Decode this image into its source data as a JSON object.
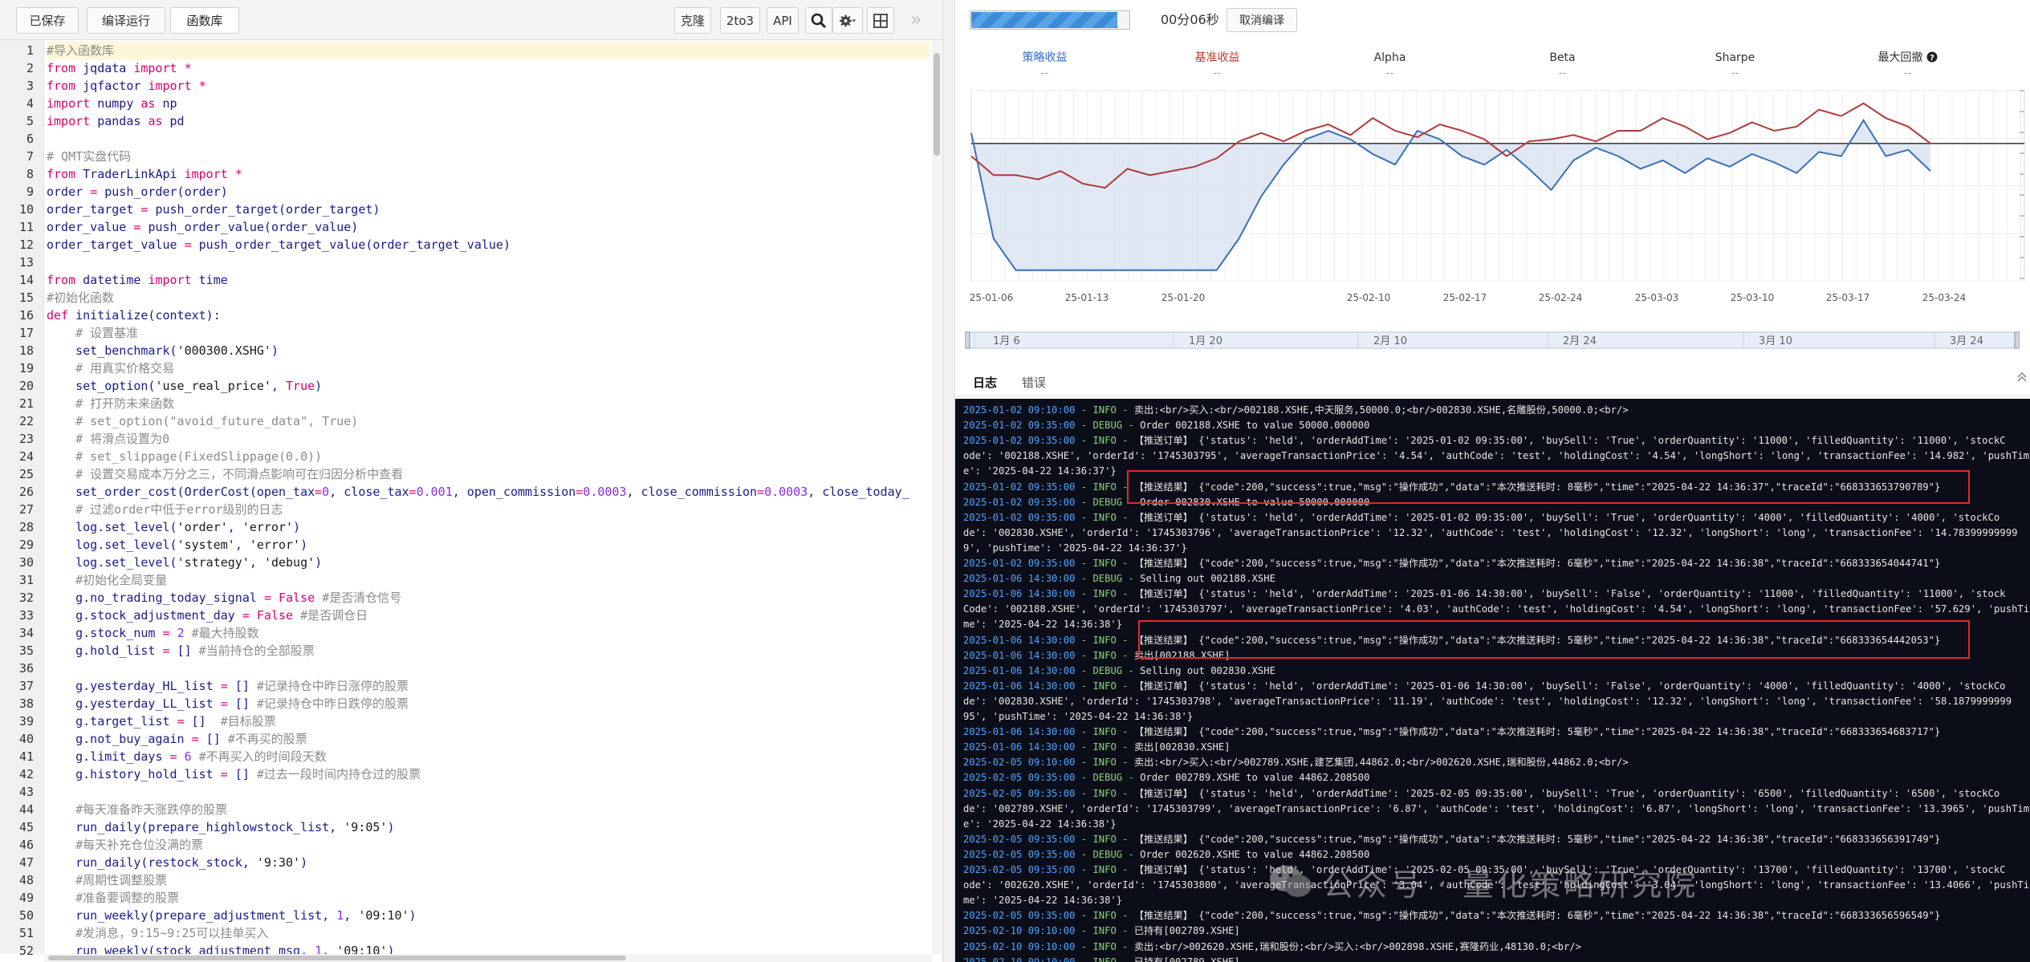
{
  "toolbar": {
    "saved": "已保存",
    "compile_run": "编译运行",
    "library": "函数库",
    "clone": "克隆",
    "to3": "2to3",
    "api": "API",
    "collapse": "»"
  },
  "code_lines": [
    [
      [
        "cm",
        "#导入函数库"
      ]
    ],
    [
      [
        "kw",
        "from "
      ],
      [
        "fn",
        "jqdata "
      ],
      [
        "kw",
        "import "
      ],
      [
        "kw",
        "*"
      ]
    ],
    [
      [
        "kw",
        "from "
      ],
      [
        "fn",
        "jqfactor "
      ],
      [
        "kw",
        "import "
      ],
      [
        "kw",
        "*"
      ]
    ],
    [
      [
        "kw",
        "import "
      ],
      [
        "fn",
        "numpy "
      ],
      [
        "kw",
        "as "
      ],
      [
        "fn",
        "np"
      ]
    ],
    [
      [
        "kw",
        "import "
      ],
      [
        "fn",
        "pandas "
      ],
      [
        "kw",
        "as "
      ],
      [
        "fn",
        "pd"
      ]
    ],
    [],
    [
      [
        "cm",
        "# QMT实盘代码"
      ]
    ],
    [
      [
        "kw",
        "from "
      ],
      [
        "fn",
        "TraderLinkApi "
      ],
      [
        "kw",
        "import "
      ],
      [
        "kw",
        "*"
      ]
    ],
    [
      [
        "fn",
        "order "
      ],
      [
        "kw",
        "= "
      ],
      [
        "fn",
        "push_order(order)"
      ]
    ],
    [
      [
        "fn",
        "order_target "
      ],
      [
        "kw",
        "= "
      ],
      [
        "fn",
        "push_order_target(order_target)"
      ]
    ],
    [
      [
        "fn",
        "order_value "
      ],
      [
        "kw",
        "= "
      ],
      [
        "fn",
        "push_order_value(order_value)"
      ]
    ],
    [
      [
        "fn",
        "order_target_value "
      ],
      [
        "kw",
        "= "
      ],
      [
        "fn",
        "push_order_target_value(order_target_value)"
      ]
    ],
    [],
    [
      [
        "kw",
        "from "
      ],
      [
        "fn",
        "datetime "
      ],
      [
        "kw",
        "import "
      ],
      [
        "fn",
        "time"
      ]
    ],
    [
      [
        "cm",
        "#初始化函数"
      ]
    ],
    [
      [
        "df",
        "def "
      ],
      [
        "fn",
        "initialize(context):"
      ]
    ],
    [
      [
        "cm",
        "    # 设置基准"
      ]
    ],
    [
      [
        "fn",
        "    set_benchmark("
      ],
      [
        "str",
        "'000300.XSHG'"
      ],
      [
        "fn",
        ")"
      ]
    ],
    [
      [
        "cm",
        "    # 用真实价格交易"
      ]
    ],
    [
      [
        "fn",
        "    set_option("
      ],
      [
        "str",
        "'use_real_price'"
      ],
      [
        "fn",
        ", "
      ],
      [
        "kw",
        "True"
      ],
      [
        "fn",
        ")"
      ]
    ],
    [
      [
        "cm",
        "    # 打开防未来函数"
      ]
    ],
    [
      [
        "cm",
        "    # set_option(\"avoid_future_data\", True)"
      ]
    ],
    [
      [
        "cm",
        "    # 将滑点设置为0"
      ]
    ],
    [
      [
        "cm",
        "    # set_slippage(FixedSlippage(0.0))"
      ]
    ],
    [
      [
        "cm",
        "    # 设置交易成本万分之三，不同滑点影响可在归因分析中查看"
      ]
    ],
    [
      [
        "fn",
        "    set_order_cost(OrderCost(open_tax"
      ],
      [
        "kw",
        "="
      ],
      [
        "num",
        "0"
      ],
      [
        "fn",
        ", close_tax"
      ],
      [
        "kw",
        "="
      ],
      [
        "num",
        "0.001"
      ],
      [
        "fn",
        ", open_commission"
      ],
      [
        "kw",
        "="
      ],
      [
        "num",
        "0.0003"
      ],
      [
        "fn",
        ", close_commission"
      ],
      [
        "kw",
        "="
      ],
      [
        "num",
        "0.0003"
      ],
      [
        "fn",
        ", close_today_"
      ]
    ],
    [
      [
        "cm",
        "    # 过滤order中低于error级别的日志"
      ]
    ],
    [
      [
        "fn",
        "    log.set_level("
      ],
      [
        "str",
        "'order'"
      ],
      [
        "fn",
        ", "
      ],
      [
        "str",
        "'error'"
      ],
      [
        "fn",
        ")"
      ]
    ],
    [
      [
        "fn",
        "    log.set_level("
      ],
      [
        "str",
        "'system'"
      ],
      [
        "fn",
        ", "
      ],
      [
        "str",
        "'error'"
      ],
      [
        "fn",
        ")"
      ]
    ],
    [
      [
        "fn",
        "    log.set_level("
      ],
      [
        "str",
        "'strategy'"
      ],
      [
        "fn",
        ", "
      ],
      [
        "str",
        "'debug'"
      ],
      [
        "fn",
        ")"
      ]
    ],
    [
      [
        "cm",
        "    #初始化全局变量"
      ]
    ],
    [
      [
        "fn",
        "    g.no_trading_today_signal "
      ],
      [
        "kw",
        "= False "
      ],
      [
        "cm",
        "#是否清仓信号"
      ]
    ],
    [
      [
        "fn",
        "    g.stock_adjustment_day "
      ],
      [
        "kw",
        "= False "
      ],
      [
        "cm",
        "#是否调仓日"
      ]
    ],
    [
      [
        "fn",
        "    g.stock_num "
      ],
      [
        "kw",
        "= "
      ],
      [
        "num",
        "2 "
      ],
      [
        "cm",
        "#最大持股数"
      ]
    ],
    [
      [
        "fn",
        "    g.hold_list "
      ],
      [
        "kw",
        "= "
      ],
      [
        "fn",
        "[] "
      ],
      [
        "cm",
        "#当前持仓的全部股票"
      ]
    ],
    [],
    [
      [
        "fn",
        "    g.yesterday_HL_list "
      ],
      [
        "kw",
        "= "
      ],
      [
        "fn",
        "[] "
      ],
      [
        "cm",
        "#记录持仓中昨日涨停的股票"
      ]
    ],
    [
      [
        "fn",
        "    g.yesterday_LL_list "
      ],
      [
        "kw",
        "= "
      ],
      [
        "fn",
        "[] "
      ],
      [
        "cm",
        "#记录持仓中昨日跌停的股票"
      ]
    ],
    [
      [
        "fn",
        "    g.target_list "
      ],
      [
        "kw",
        "= "
      ],
      [
        "fn",
        "[]  "
      ],
      [
        "cm",
        "#目标股票"
      ]
    ],
    [
      [
        "fn",
        "    g.not_buy_again "
      ],
      [
        "kw",
        "= "
      ],
      [
        "fn",
        "[] "
      ],
      [
        "cm",
        "#不再买的股票"
      ]
    ],
    [
      [
        "fn",
        "    g.limit_days "
      ],
      [
        "kw",
        "= "
      ],
      [
        "num",
        "6 "
      ],
      [
        "cm",
        "#不再买入的时间段天数"
      ]
    ],
    [
      [
        "fn",
        "    g.history_hold_list "
      ],
      [
        "kw",
        "= "
      ],
      [
        "fn",
        "[] "
      ],
      [
        "cm",
        "#过去一段时间内持仓过的股票"
      ]
    ],
    [],
    [
      [
        "cm",
        "    #每天准备昨天涨跌停的股票"
      ]
    ],
    [
      [
        "fn",
        "    run_daily(prepare_highlowstock_list, "
      ],
      [
        "str",
        "'9:05'"
      ],
      [
        "fn",
        ")"
      ]
    ],
    [
      [
        "cm",
        "    #每天补充仓位没满的票"
      ]
    ],
    [
      [
        "fn",
        "    run_daily(restock_stock, "
      ],
      [
        "str",
        "'9:30'"
      ],
      [
        "fn",
        ")"
      ]
    ],
    [
      [
        "cm",
        "    #周期性调整股票"
      ]
    ],
    [
      [
        "cm",
        "    #准备要调整的股票"
      ]
    ],
    [
      [
        "fn",
        "    run_weekly(prepare_adjustment_list, "
      ],
      [
        "num",
        "1"
      ],
      [
        "fn",
        ", "
      ],
      [
        "str",
        "'09:10'"
      ],
      [
        "fn",
        ")"
      ]
    ],
    [
      [
        "cm",
        "    #发消息，9:15~9:25可以挂单买入"
      ]
    ],
    [
      [
        "fn",
        "    run_weekly(stock_adjustment_msg, "
      ],
      [
        "num",
        "1"
      ],
      [
        "fn",
        ", "
      ],
      [
        "str",
        "'09:10'"
      ],
      [
        "fn",
        ")"
      ]
    ]
  ],
  "progress": {
    "fraction": 0.93,
    "time": "00分06秒",
    "cancel": "取消编译"
  },
  "metrics": [
    {
      "label": "策略收益",
      "value": "--",
      "color": "#2f6fc8"
    },
    {
      "label": "基准收益",
      "value": "--",
      "color": "#c0392b"
    },
    {
      "label": "Alpha",
      "value": "--",
      "color": "#333333"
    },
    {
      "label": "Beta",
      "value": "--",
      "color": "#333333"
    },
    {
      "label": "Sharpe",
      "value": "--",
      "color": "#333333"
    },
    {
      "label": "最大回撤",
      "value": "--",
      "color": "#333333"
    }
  ],
  "chart_data": {
    "type": "line",
    "title": "",
    "x_ticks": [
      "25-01-06",
      "25-01-13",
      "25-01-20",
      "25-02-10",
      "25-02-17",
      "25-02-24",
      "25-03-03",
      "25-03-10",
      "25-03-17",
      "25-03-24"
    ],
    "navigator_ticks": [
      "1月 6",
      "1月 20",
      "2月 10",
      "2月 24",
      "3月 10",
      "3月 24"
    ],
    "series": [
      {
        "name": "策略收益",
        "color": "#3a6fb8",
        "values": [
          0.5,
          -4.5,
          -6,
          -6,
          -6,
          -6,
          -6,
          -6,
          -6,
          -6,
          -6,
          -6,
          -4.5,
          -2.5,
          -1,
          0.2,
          0.6,
          0.2,
          -0.5,
          -1,
          0.6,
          0.2,
          -0.6,
          -1,
          -0.3,
          -1.2,
          -2.2,
          -0.8,
          -0.2,
          -0.6,
          -1.2,
          -0.8,
          -1.4,
          -0.7,
          -1.1,
          -0.5,
          -0.9,
          -1.4,
          -0.4,
          -0.6,
          1.1,
          -0.6,
          -0.3,
          -1.3
        ]
      },
      {
        "name": "基准收益",
        "color": "#b03a3a",
        "values": [
          -0.6,
          -1.5,
          -1.5,
          -1.7,
          -1.3,
          -1.9,
          -2.1,
          -1.2,
          -1.5,
          -1.3,
          -1.1,
          -0.7,
          0.1,
          0.5,
          0.1,
          0.6,
          0.9,
          0.4,
          1.2,
          0.6,
          0.3,
          0.9,
          0.6,
          0.2,
          -0.6,
          0.1,
          0.2,
          0.4,
          0.1,
          0.6,
          0.6,
          1.2,
          0.8,
          0.2,
          0.5,
          1,
          0.6,
          0.8,
          1.6,
          1.3,
          1.9,
          1.2,
          0.8,
          0
        ]
      }
    ],
    "ylim": [
      -6.5,
      2.5
    ],
    "grid": true
  },
  "tabs": {
    "log": "日志",
    "error": "错误"
  },
  "log_lines": [
    {
      "t": "2025-01-02 09:10:00",
      "lv": "INFO",
      "m": "卖出:<br/>买入:<br/>002188.XSHE,中天服务,50000.0;<br/>002830.XSHE,名雕股份,50000.0;<br/>"
    },
    {
      "t": "2025-01-02 09:35:00",
      "lv": "DEBUG",
      "m": "Order 002188.XSHE to value 50000.000000"
    },
    {
      "t": "2025-01-02 09:35:00",
      "lv": "INFO",
      "m": "【推送订单】 {'status': 'held', 'orderAddTime': '2025-01-02 09:35:00', 'buySell': 'True', 'orderQuantity': '11000', 'filledQuantity': '11000', 'stockC"
    },
    {
      "t": "",
      "lv": "",
      "m": "ode': '002188.XSHE', 'orderId': '1745303795', 'averageTransactionPrice': '4.54', 'authCode': 'test', 'holdingCost': '4.54', 'longShort': 'long', 'transactionFee': '14.982', 'pushTim"
    },
    {
      "t": "",
      "lv": "",
      "m": "e': '2025-04-22 14:36:37'}"
    },
    {
      "t": "2025-01-02 09:35:00",
      "lv": "INFO",
      "m": "【推送结果】 {\"code\":200,\"success\":true,\"msg\":\"操作成功\",\"data\":\"本次推送耗时: 8毫秒\",\"time\":\"2025-04-22 14:36:37\",\"traceId\":\"668333653790789\"}"
    },
    {
      "t": "2025-01-02 09:35:00",
      "lv": "DEBUG",
      "m": "Order 002830.XSHE to value 50000.000000"
    },
    {
      "t": "2025-01-02 09:35:00",
      "lv": "INFO",
      "m": "【推送订单】 {'status': 'held', 'orderAddTime': '2025-01-02 09:35:00', 'buySell': 'True', 'orderQuantity': '4000', 'filledQuantity': '4000', 'stockCo"
    },
    {
      "t": "",
      "lv": "",
      "m": "de': '002830.XSHE', 'orderId': '1745303796', 'averageTransactionPrice': '12.32', 'authCode': 'test', 'holdingCost': '12.32', 'longShort': 'long', 'transactionFee': '14.78399999999"
    },
    {
      "t": "",
      "lv": "",
      "m": "9', 'pushTime': '2025-04-22 14:36:37'}"
    },
    {
      "t": "2025-01-02 09:35:00",
      "lv": "INFO",
      "m": "【推送结果】 {\"code\":200,\"success\":true,\"msg\":\"操作成功\",\"data\":\"本次推送耗时: 6毫秒\",\"time\":\"2025-04-22 14:36:38\",\"traceId\":\"668333654044741\"}"
    },
    {
      "t": "2025-01-06 14:30:00",
      "lv": "DEBUG",
      "m": "Selling out 002188.XSHE"
    },
    {
      "t": "2025-01-06 14:30:00",
      "lv": "INFO",
      "m": "【推送订单】 {'status': 'held', 'orderAddTime': '2025-01-06 14:30:00', 'buySell': 'False', 'orderQuantity': '11000', 'filledQuantity': '11000', 'stock"
    },
    {
      "t": "",
      "lv": "",
      "m": "Code': '002188.XSHE', 'orderId': '1745303797', 'averageTransactionPrice': '4.03', 'authCode': 'test', 'holdingCost': '4.54', 'longShort': 'long', 'transactionFee': '57.629', 'pushTi"
    },
    {
      "t": "",
      "lv": "",
      "m": "me': '2025-04-22 14:36:38'}"
    },
    {
      "t": "2025-01-06 14:30:00",
      "lv": "INFO",
      "m": "【推送结果】 {\"code\":200,\"success\":true,\"msg\":\"操作成功\",\"data\":\"本次推送耗时: 5毫秒\",\"time\":\"2025-04-22 14:36:38\",\"traceId\":\"668333654442053\"}"
    },
    {
      "t": "2025-01-06 14:30:00",
      "lv": "INFO",
      "m": "卖出[002188.XSHE]"
    },
    {
      "t": "2025-01-06 14:30:00",
      "lv": "DEBUG",
      "m": "Selling out 002830.XSHE"
    },
    {
      "t": "2025-01-06 14:30:00",
      "lv": "INFO",
      "m": "【推送订单】 {'status': 'held', 'orderAddTime': '2025-01-06 14:30:00', 'buySell': 'False', 'orderQuantity': '4000', 'filledQuantity': '4000', 'stockCo"
    },
    {
      "t": "",
      "lv": "",
      "m": "de': '002830.XSHE', 'orderId': '1745303798', 'averageTransactionPrice': '11.19', 'authCode': 'test', 'holdingCost': '12.32', 'longShort': 'long', 'transactionFee': '58.1879999999"
    },
    {
      "t": "",
      "lv": "",
      "m": "95', 'pushTime': '2025-04-22 14:36:38'}"
    },
    {
      "t": "2025-01-06 14:30:00",
      "lv": "INFO",
      "m": "【推送结果】 {\"code\":200,\"success\":true,\"msg\":\"操作成功\",\"data\":\"本次推送耗时: 5毫秒\",\"time\":\"2025-04-22 14:36:38\",\"traceId\":\"668333654683717\"}"
    },
    {
      "t": "2025-01-06 14:30:00",
      "lv": "INFO",
      "m": "卖出[002830.XSHE]"
    },
    {
      "t": "2025-02-05 09:10:00",
      "lv": "INFO",
      "m": "卖出:<br/>买入:<br/>002789.XSHE,建艺集团,44862.0;<br/>002620.XSHE,瑞和股份,44862.0;<br/>"
    },
    {
      "t": "2025-02-05 09:35:00",
      "lv": "DEBUG",
      "m": "Order 002789.XSHE to value 44862.208500"
    },
    {
      "t": "2025-02-05 09:35:00",
      "lv": "INFO",
      "m": "【推送订单】 {'status': 'held', 'orderAddTime': '2025-02-05 09:35:00', 'buySell': 'True', 'orderQuantity': '6500', 'filledQuantity': '6500', 'stockCo"
    },
    {
      "t": "",
      "lv": "",
      "m": "de': '002789.XSHE', 'orderId': '1745303799', 'averageTransactionPrice': '6.87', 'authCode': 'test', 'holdingCost': '6.87', 'longShort': 'long', 'transactionFee': '13.3965', 'pushTim"
    },
    {
      "t": "",
      "lv": "",
      "m": "e': '2025-04-22 14:36:38'}"
    },
    {
      "t": "2025-02-05 09:35:00",
      "lv": "INFO",
      "m": "【推送结果】 {\"code\":200,\"success\":true,\"msg\":\"操作成功\",\"data\":\"本次推送耗时: 5毫秒\",\"time\":\"2025-04-22 14:36:38\",\"traceId\":\"668333656391749\"}"
    },
    {
      "t": "2025-02-05 09:35:00",
      "lv": "DEBUG",
      "m": "Order 002620.XSHE to value 44862.208500"
    },
    {
      "t": "2025-02-05 09:35:00",
      "lv": "INFO",
      "m": "【推送订单】 {'status': 'held', 'orderAddTime': '2025-02-05 09:35:00', 'buySell': 'True', 'orderQuantity': '13700', 'filledQuantity': '13700', 'stockC"
    },
    {
      "t": "",
      "lv": "",
      "m": "ode': '002620.XSHE', 'orderId': '1745303800', 'averageTransactionPrice': '3.04', 'authCode': 'test', 'holdingCost': '3.04', 'longShort': 'long', 'transactionFee': '13.4066', 'pushTi"
    },
    {
      "t": "",
      "lv": "",
      "m": "me': '2025-04-22 14:36:38'}"
    },
    {
      "t": "2025-02-05 09:35:00",
      "lv": "INFO",
      "m": "【推送结果】 {\"code\":200,\"success\":true,\"msg\":\"操作成功\",\"data\":\"本次推送耗时: 6毫秒\",\"time\":\"2025-04-22 14:36:38\",\"traceId\":\"668333656596549\"}"
    },
    {
      "t": "2025-02-10 09:10:00",
      "lv": "INFO",
      "m": "已持有[002789.XSHE]"
    },
    {
      "t": "2025-02-10 09:10:00",
      "lv": "INFO",
      "m": "卖出:<br/>002620.XSHE,瑞和股份;<br/>买入:<br/>002898.XSHE,赛隆药业,48130.0;<br/>"
    },
    {
      "t": "2025-02-10 09:10:00",
      "lv": "INFO",
      "m": "已持有[002789.XSHE]"
    }
  ],
  "watermark": "公众号 · 量化策略研究院"
}
